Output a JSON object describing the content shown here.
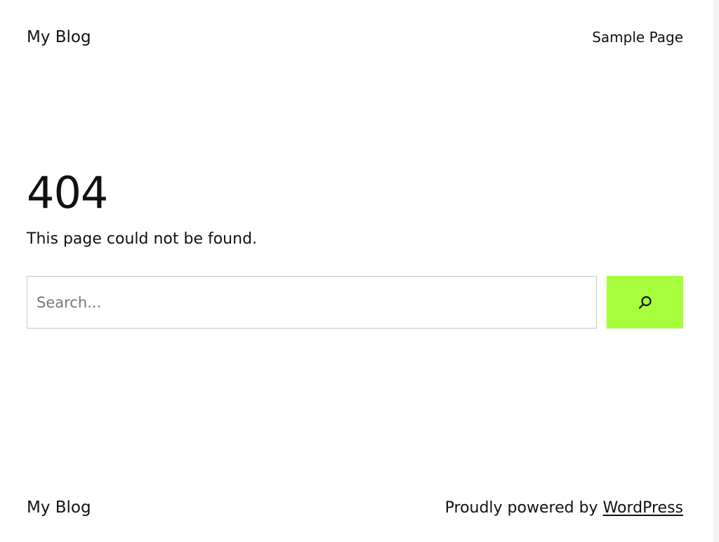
{
  "header": {
    "site_title": "My Blog",
    "nav_link": "Sample Page"
  },
  "main": {
    "error_code": "404",
    "error_message": "This page could not be found."
  },
  "search": {
    "placeholder": "Search...",
    "button_icon": "search-icon",
    "button_color": "#a6ff3a"
  },
  "footer": {
    "site_title": "My Blog",
    "credit_prefix": "Proudly powered by ",
    "credit_link": "WordPress"
  }
}
